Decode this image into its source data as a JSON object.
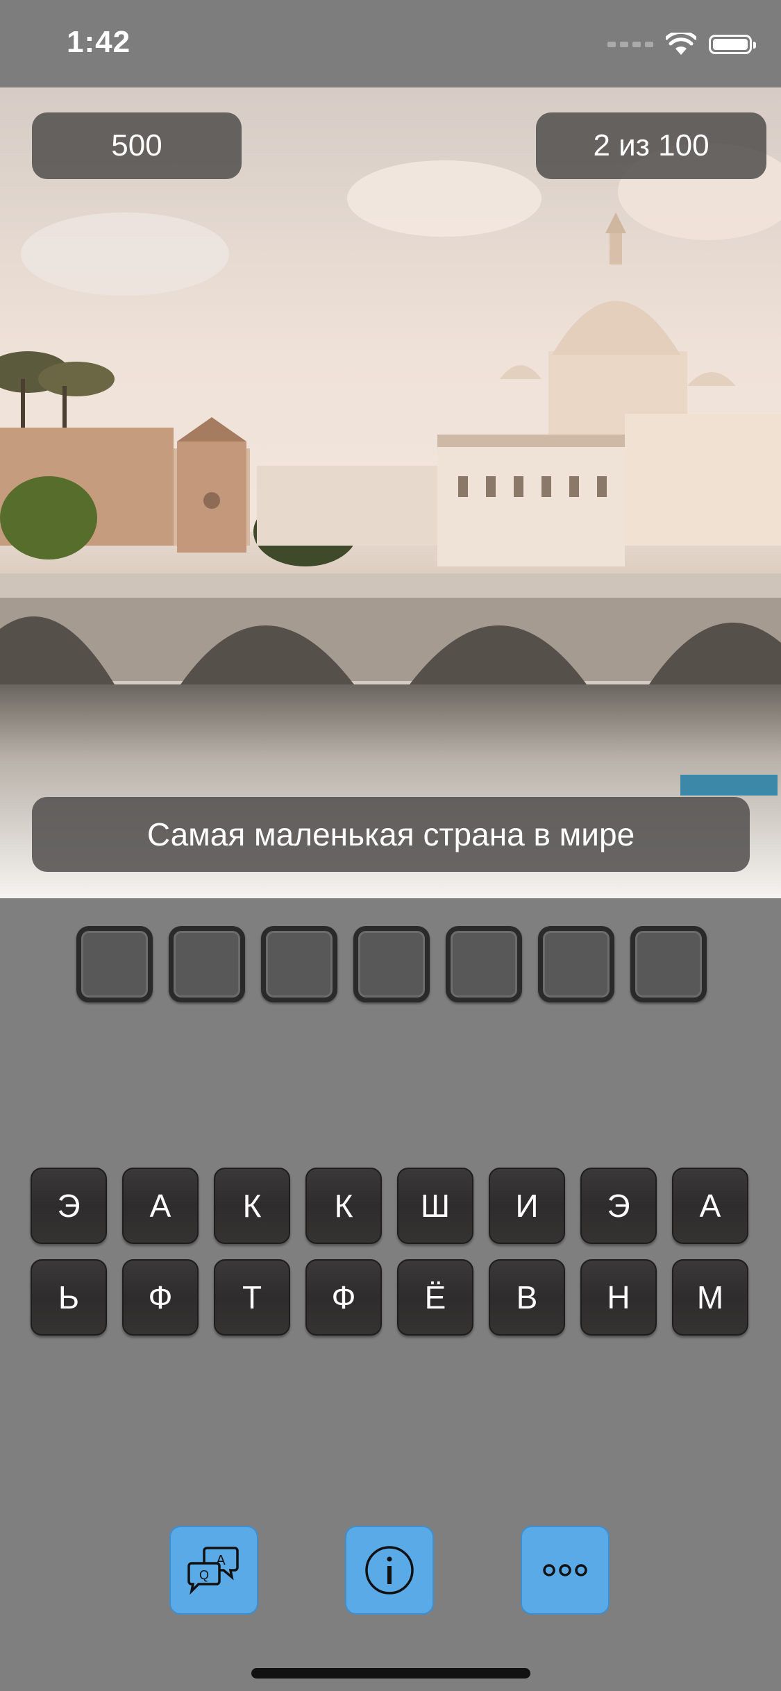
{
  "status_bar": {
    "time": "1:42"
  },
  "header": {
    "score": "500",
    "progress": "2 из 100"
  },
  "question": {
    "text": "Самая маленькая страна в мире"
  },
  "answer": {
    "slot_count": 7
  },
  "keyboard": {
    "rows": [
      [
        "Э",
        "А",
        "К",
        "К",
        "Ш",
        "И",
        "Э",
        "А"
      ],
      [
        "Ь",
        "Ф",
        "Т",
        "Ф",
        "Ё",
        "В",
        "Н",
        "М"
      ]
    ]
  },
  "actions": [
    {
      "name": "qa-hint-button",
      "icon": "qa-chat-icon"
    },
    {
      "name": "info-button",
      "icon": "info-icon"
    },
    {
      "name": "more-button",
      "icon": "more-dots-icon"
    }
  ],
  "colors": {
    "background": "#7f7f7f",
    "action_button": "#5aaae8",
    "key": "#333131"
  }
}
